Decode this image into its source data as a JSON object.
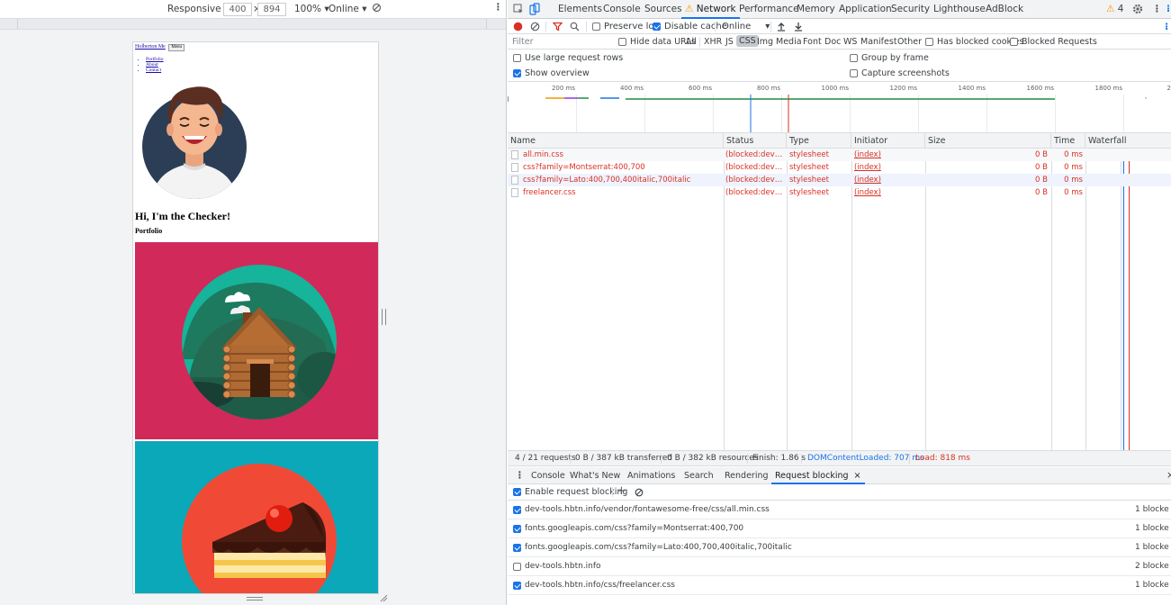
{
  "device_toolbar": {
    "device": "Responsive",
    "width": "400",
    "times": "×",
    "height": "894",
    "zoom": "100%",
    "throttle": "Online"
  },
  "page": {
    "brand": "Holberton Me",
    "menu_button": "Menu",
    "links": [
      "Portfolio",
      "About",
      "Contact"
    ],
    "heading": "Hi, I'm the Checker!",
    "subheading": "Portfolio"
  },
  "devtools": {
    "tabs": [
      "Elements",
      "Console",
      "Sources",
      "Network",
      "Performance",
      "Memory",
      "Application",
      "Security",
      "Lighthouse",
      "AdBlock"
    ],
    "warning_count": "4",
    "network_toolbar": {
      "preserve_log": "Preserve log",
      "disable_cache": "Disable cache",
      "throttle": "Online"
    },
    "filter": {
      "placeholder": "Filter",
      "hide_data_urls": "Hide data URLs",
      "types": [
        "All",
        "XHR",
        "JS",
        "CSS",
        "Img",
        "Media",
        "Font",
        "Doc",
        "WS",
        "Manifest",
        "Other"
      ],
      "active_type": "CSS",
      "has_blocked_cookies": "Has blocked cookies",
      "blocked_requests": "Blocked Requests"
    },
    "settings": {
      "large_rows": "Use large request rows",
      "show_overview": "Show overview",
      "group_by_frame": "Group by frame",
      "capture_screenshots": "Capture screenshots"
    },
    "overview_ticks": [
      "200 ms",
      "400 ms",
      "600 ms",
      "800 ms",
      "1000 ms",
      "1200 ms",
      "1400 ms",
      "1600 ms",
      "1800 ms",
      "2"
    ],
    "table": {
      "headers": [
        "Name",
        "Status",
        "Type",
        "Initiator",
        "Size",
        "Time",
        "Waterfall"
      ],
      "rows": [
        {
          "name": "all.min.css",
          "status": "(blocked:devto…",
          "type": "stylesheet",
          "initiator": "(index)",
          "size": "0 B",
          "time": "0 ms"
        },
        {
          "name": "css?family=Montserrat:400,700",
          "status": "(blocked:devto…",
          "type": "stylesheet",
          "initiator": "(index)",
          "size": "0 B",
          "time": "0 ms"
        },
        {
          "name": "css?family=Lato:400,700,400italic,700italic",
          "status": "(blocked:devto…",
          "type": "stylesheet",
          "initiator": "(index)",
          "size": "0 B",
          "time": "0 ms"
        },
        {
          "name": "freelancer.css",
          "status": "(blocked:devto…",
          "type": "stylesheet",
          "initiator": "(index)",
          "size": "0 B",
          "time": "0 ms"
        }
      ]
    },
    "status_bar": {
      "requests": "4 / 21 requests",
      "transferred": "0 B / 387 kB transferred",
      "resources": "0 B / 382 kB resources",
      "finish": "Finish: 1.86 s",
      "dcl": "DOMContentLoaded: 707 ms",
      "load": "Load: 818 ms"
    },
    "drawer_tabs": [
      "Console",
      "What's New",
      "Animations",
      "Search",
      "Rendering",
      "Request blocking"
    ],
    "request_blocking": {
      "enable_label": "Enable request blocking",
      "patterns": [
        {
          "pattern": "dev-tools.hbtn.info/vendor/fontawesome-free/css/all.min.css",
          "count": "1 blocke",
          "enabled": true
        },
        {
          "pattern": "fonts.googleapis.com/css?family=Montserrat:400,700",
          "count": "1 blocke",
          "enabled": true
        },
        {
          "pattern": "fonts.googleapis.com/css?family=Lato:400,700,400italic,700italic",
          "count": "1 blocke",
          "enabled": true
        },
        {
          "pattern": "dev-tools.hbtn.info",
          "count": "2 blocke",
          "enabled": false
        },
        {
          "pattern": "dev-tools.hbtn.info/css/freelancer.css",
          "count": "1 blocke",
          "enabled": true
        }
      ]
    }
  },
  "colors": {
    "accent": "#1a73e8",
    "error": "#d93025",
    "cabin_bg": "#d1295a",
    "cake_bg": "#0aa8b8",
    "dcl_line": "#1a73e8",
    "load_line": "#d93025"
  }
}
